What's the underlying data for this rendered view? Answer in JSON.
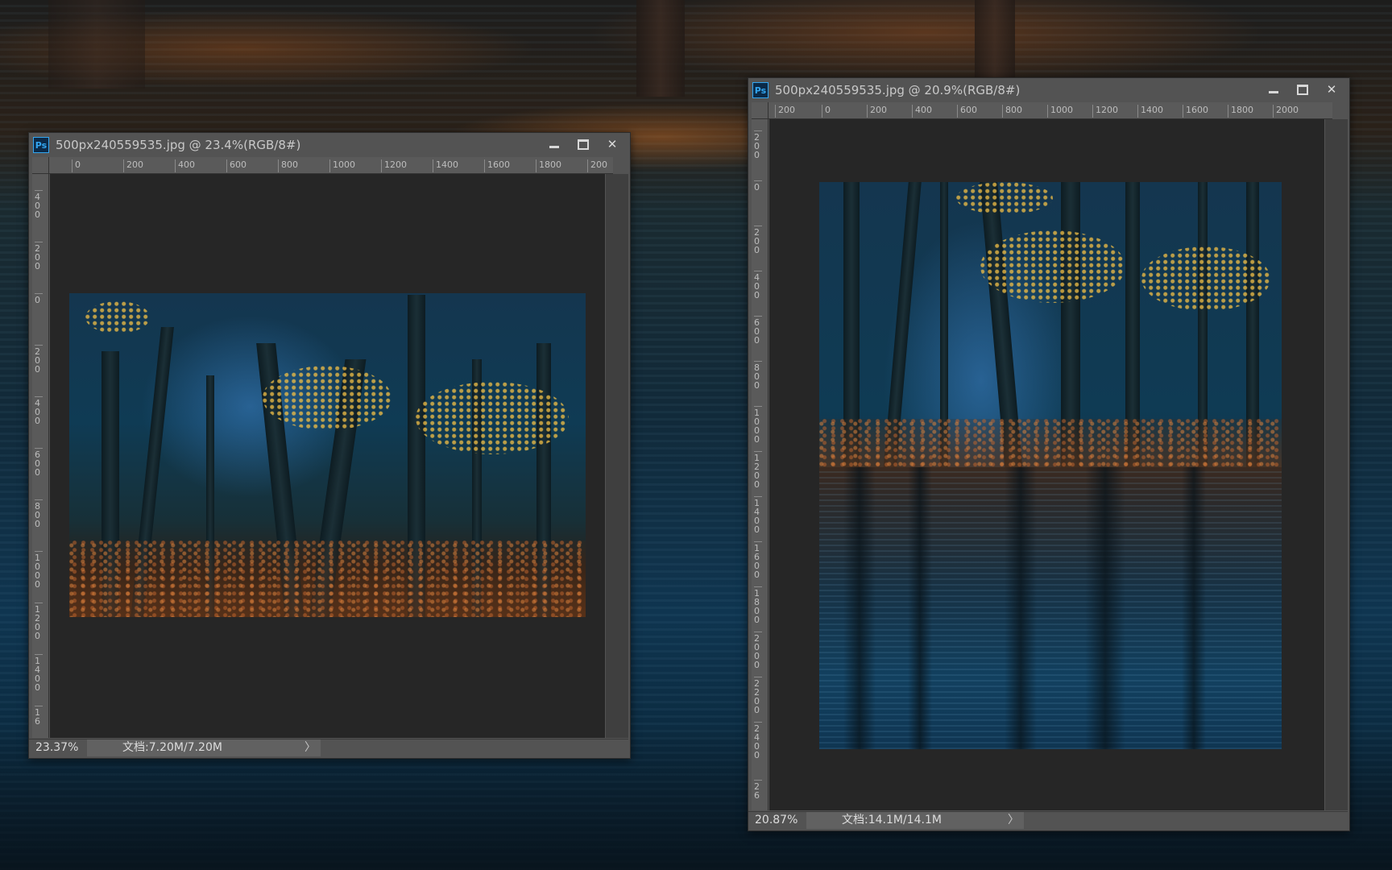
{
  "windows": [
    {
      "title": "500px240559535.jpg @ 23.4%(RGB/8#)",
      "app_icon": "Ps",
      "ruler_h": [
        "0",
        "200",
        "400",
        "600",
        "800",
        "1000",
        "1200",
        "1400",
        "1600",
        "1800",
        "200"
      ],
      "ruler_v": [
        "400",
        "200",
        "0",
        "200",
        "400",
        "600",
        "800",
        "1000",
        "1200",
        "1400",
        "16"
      ],
      "zoom": "23.37%",
      "doc_size": "文档:7.20M/7.20M",
      "status_arrow": "〉"
    },
    {
      "title": "500px240559535.jpg @ 20.9%(RGB/8#)",
      "app_icon": "Ps",
      "ruler_h": [
        "200",
        "0",
        "200",
        "400",
        "600",
        "800",
        "1000",
        "1200",
        "1400",
        "1600",
        "1800",
        "2000"
      ],
      "ruler_v": [
        "200",
        "0",
        "200",
        "400",
        "600",
        "800",
        "1000",
        "1200",
        "1400",
        "1600",
        "1800",
        "2000",
        "2200",
        "2400",
        "26"
      ],
      "zoom": "20.87%",
      "doc_size": "文档:14.1M/14.1M",
      "status_arrow": "〉"
    }
  ],
  "icons": {
    "minimize": "minimize-icon",
    "maximize": "maximize-icon",
    "close": "close-icon",
    "close_glyph": "✕"
  },
  "colors": {
    "panel": "#535353",
    "canvas": "#262626",
    "ps_blue": "#33a6f0"
  }
}
